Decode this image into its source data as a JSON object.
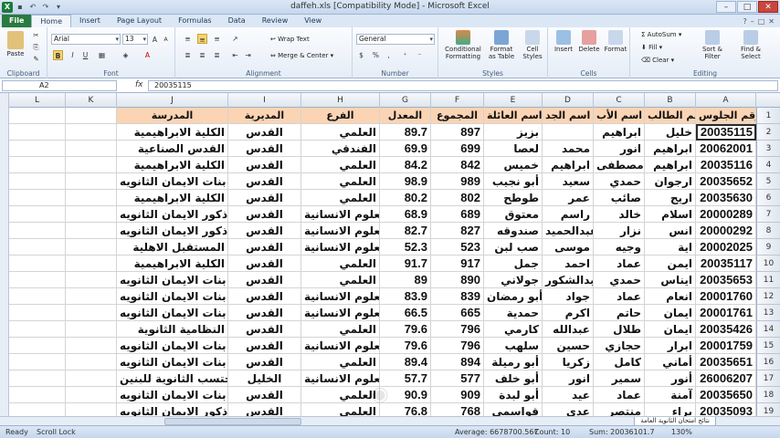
{
  "window": {
    "title": "daffeh.xls  [Compatibility Mode]  -  Microsoft Excel",
    "min": "–",
    "max": "□",
    "close": "✕"
  },
  "tabs": [
    "File",
    "Home",
    "Insert",
    "Page Layout",
    "Formulas",
    "Data",
    "Review",
    "View"
  ],
  "ribbon": {
    "clipboard": {
      "label": "Clipboard",
      "paste": "Paste"
    },
    "font": {
      "label": "Font",
      "name": "Arial",
      "size": "13",
      "bold": "B",
      "italic": "I",
      "underline": "U"
    },
    "alignment": {
      "label": "Alignment",
      "wrap": "Wrap Text",
      "merge": "Merge & Center"
    },
    "number": {
      "label": "Number",
      "format": "General",
      "percent": "%"
    },
    "styles": {
      "label": "Styles",
      "cond": "Conditional Formatting",
      "table": "Format as Table",
      "cell": "Cell Styles"
    },
    "cells": {
      "label": "Cells",
      "insert": "Insert",
      "delete": "Delete",
      "format": "Format"
    },
    "editing": {
      "label": "Editing",
      "autosum": "AutoSum",
      "fill": "Fill",
      "clear": "Clear",
      "sort": "Sort & Filter",
      "find": "Find & Select"
    }
  },
  "formula": {
    "namebox": "A2",
    "fx": "fx",
    "value": "20035115"
  },
  "columns": [
    "L",
    "K",
    "J",
    "I",
    "H",
    "G",
    "F",
    "E",
    "D",
    "C",
    "B",
    "A"
  ],
  "headers": {
    "J": "المدرسة",
    "I": "المديرية",
    "H": "الفرع",
    "G": "المعدل",
    "F": "المجموع",
    "E": "اسم العائلة",
    "D": "اسم الجد",
    "C": "اسم الأب",
    "B": "اسم الطالب",
    "A": "رقم الجلوس"
  },
  "rows": [
    {
      "n": "2",
      "A": "20035115",
      "B": "خليل",
      "C": "ابراهيم",
      "D": "",
      "E": "بزيز",
      "F": "897",
      "G": "89.7",
      "H": "العلمي",
      "I": "القدس",
      "J": "الكلية الابراهيمية"
    },
    {
      "n": "3",
      "A": "20062001",
      "B": "ابراهيم",
      "C": "انور",
      "D": "محمد",
      "E": "لعصا",
      "F": "699",
      "G": "69.9",
      "H": "الفندقي",
      "I": "القدس",
      "J": "القدس الصناعية"
    },
    {
      "n": "4",
      "A": "20035116",
      "B": "ابراهيم",
      "C": "مصطفى",
      "D": "ابراهيم",
      "E": "خميس",
      "F": "842",
      "G": "84.2",
      "H": "العلمي",
      "I": "القدس",
      "J": "الكلية الابراهيمية"
    },
    {
      "n": "5",
      "A": "20035652",
      "B": "ارجوان",
      "C": "حمدي",
      "D": "سعيد",
      "E": "أبو نجيب",
      "F": "989",
      "G": "98.9",
      "H": "العلمي",
      "I": "القدس",
      "J": "بنات الايمان الثانويه"
    },
    {
      "n": "6",
      "A": "20035630",
      "B": "اريج",
      "C": "صائب",
      "D": "عمر",
      "E": "طوطح",
      "F": "802",
      "G": "80.2",
      "H": "العلمي",
      "I": "القدس",
      "J": "الكلية الابراهيمية"
    },
    {
      "n": "7",
      "A": "20000289",
      "B": "اسلام",
      "C": "خالد",
      "D": "راسم",
      "E": "معتوق",
      "F": "689",
      "G": "68.9",
      "H": "العلوم الانسانية",
      "I": "القدس",
      "J": "ذكور الايمان الثانويه"
    },
    {
      "n": "8",
      "A": "20000292",
      "B": "انس",
      "C": "نزار",
      "D": "عبدالحميد",
      "E": "صندوقه",
      "F": "827",
      "G": "82.7",
      "H": "العلوم الانسانية",
      "I": "القدس",
      "J": "ذكور الايمان الثانويه"
    },
    {
      "n": "9",
      "A": "20002025",
      "B": "اية",
      "C": "وجيه",
      "D": "موسى",
      "E": "صب لبن",
      "F": "523",
      "G": "52.3",
      "H": "العلوم الانسانية",
      "I": "القدس",
      "J": "المستقبل الاهلية"
    },
    {
      "n": "10",
      "A": "20035117",
      "B": "ايمن",
      "C": "عماد",
      "D": "احمد",
      "E": "جمل",
      "F": "917",
      "G": "91.7",
      "H": "العلمي",
      "I": "القدس",
      "J": "الكلية الابراهيمية"
    },
    {
      "n": "11",
      "A": "20035653",
      "B": "ايناس",
      "C": "حمدي",
      "D": "عبدالشكور",
      "E": "جولاني",
      "F": "890",
      "G": "89",
      "H": "العلمي",
      "I": "القدس",
      "J": "بنات الايمان الثانويه"
    },
    {
      "n": "12",
      "A": "20001760",
      "B": "انعام",
      "C": "عماد",
      "D": "جواد",
      "E": "أبو رمضان",
      "F": "839",
      "G": "83.9",
      "H": "العلوم الانسانية",
      "I": "القدس",
      "J": "بنات الايمان الثانويه"
    },
    {
      "n": "13",
      "A": "20001761",
      "B": "ايمان",
      "C": "حاتم",
      "D": "اكرم",
      "E": "حمدية",
      "F": "665",
      "G": "66.5",
      "H": "العلوم الانسانية",
      "I": "القدس",
      "J": "بنات الايمان الثانويه"
    },
    {
      "n": "14",
      "A": "20035426",
      "B": "ايمان",
      "C": "طلال",
      "D": "عبدالله",
      "E": "كارمي",
      "F": "796",
      "G": "79.6",
      "H": "العلمي",
      "I": "القدس",
      "J": "النظامية الثانوية"
    },
    {
      "n": "15",
      "A": "20001759",
      "B": "ابرار",
      "C": "حجازي",
      "D": "حسين",
      "E": "سلهب",
      "F": "796",
      "G": "79.6",
      "H": "العلوم الانسانية",
      "I": "القدس",
      "J": "بنات الايمان الثانويه"
    },
    {
      "n": "16",
      "A": "20035651",
      "B": "أماني",
      "C": "كامل",
      "D": "زكريا",
      "E": "أبو رميلة",
      "F": "894",
      "G": "89.4",
      "H": "العلمي",
      "I": "القدس",
      "J": "بنات الايمان الثانويه"
    },
    {
      "n": "17",
      "A": "26006207",
      "B": "أنور",
      "C": "سمير",
      "D": "انور",
      "E": "أبو خلف",
      "F": "577",
      "G": "57.7",
      "H": "العلوم الانسانية",
      "I": "الخليل",
      "J": "حكمت المحتسب الثانوية للبنين"
    },
    {
      "n": "18",
      "A": "20035650",
      "B": "آمنة",
      "C": "عماد",
      "D": "عيد",
      "E": "أبو لبدة",
      "F": "909",
      "G": "90.9",
      "H": "العلمي",
      "I": "القدس",
      "J": "بنات الايمان الثانويه"
    },
    {
      "n": "19",
      "A": "20035093",
      "B": "براء",
      "C": "منتصر",
      "D": "عدي",
      "E": "قواسمي",
      "F": "768",
      "G": "76.8",
      "H": "العلمي",
      "I": "القدس",
      "J": "ذكور الايمان الثانويه"
    }
  ],
  "status": {
    "ready": "Ready",
    "scroll": "Scroll Lock",
    "average": "Average: 6678700.567",
    "count": "Count: 10",
    "sum": "Sum: 20036101.7",
    "zoom": "130%",
    "sheet": "نتائج امتحان الثانوية العامة"
  }
}
